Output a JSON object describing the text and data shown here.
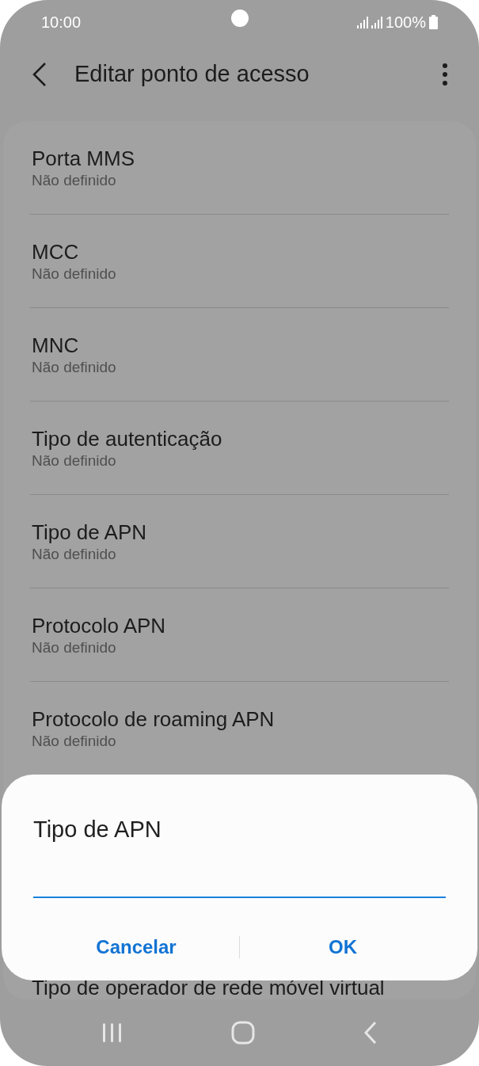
{
  "status_bar": {
    "time": "10:00",
    "battery": "100%"
  },
  "header": {
    "title": "Editar ponto de acesso"
  },
  "settings_items": [
    {
      "title": "Porta MMS",
      "value": "Não definido"
    },
    {
      "title": "MCC",
      "value": "Não definido"
    },
    {
      "title": "MNC",
      "value": "Não definido"
    },
    {
      "title": "Tipo de autenticação",
      "value": "Não definido"
    },
    {
      "title": "Tipo de APN",
      "value": "Não definido"
    },
    {
      "title": "Protocolo APN",
      "value": "Não definido"
    },
    {
      "title": "Protocolo de roaming APN",
      "value": "Não definido"
    }
  ],
  "partial_item": {
    "title": "Tipo de operador de rede móvel virtual"
  },
  "dialog": {
    "title": "Tipo de APN",
    "buttons": [
      "Cancelar",
      "OK"
    ]
  }
}
